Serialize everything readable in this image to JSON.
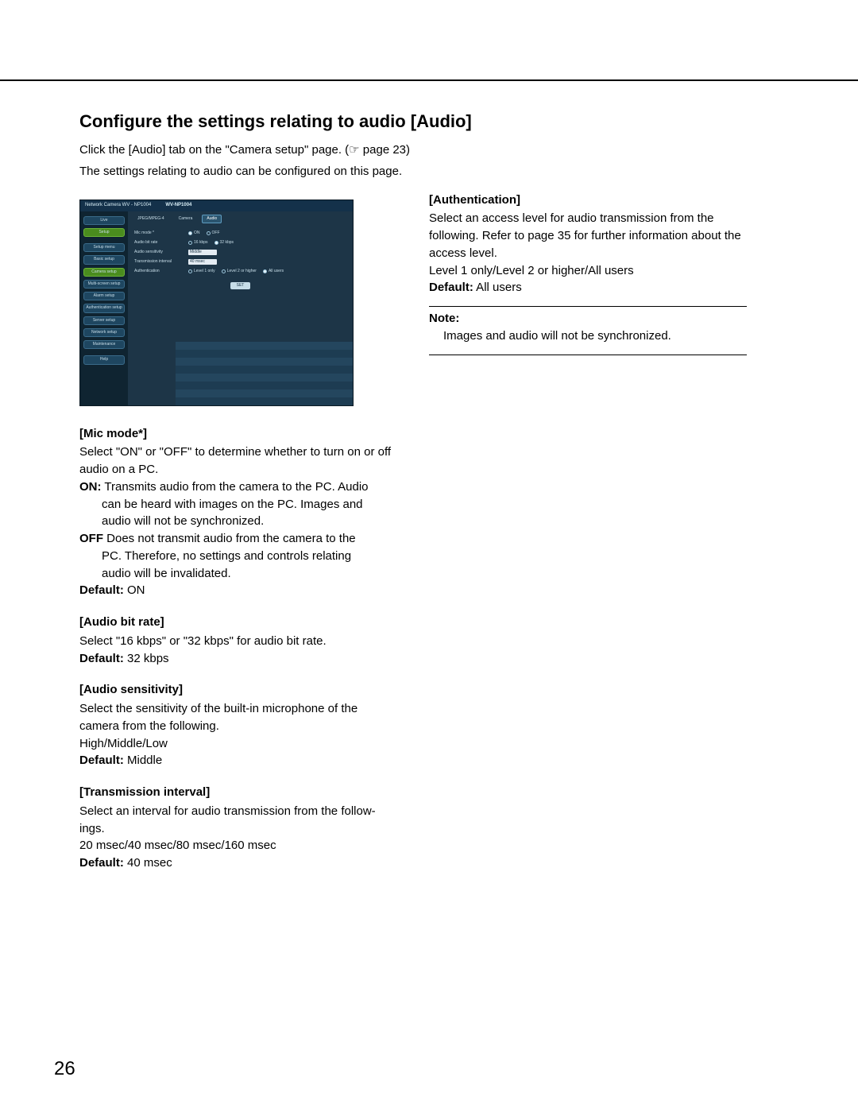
{
  "page": {
    "title": "Configure the settings relating to audio [Audio]",
    "lead_1": "Click the [Audio] tab on the \"Camera setup\" page. (",
    "lead_hand": "☞",
    "lead_pageref": " page 23)",
    "lead_2": "The settings relating to audio can be configured on this page.",
    "number": "26"
  },
  "screenshot": {
    "brand_line": "Network Camera  WV - NP1004",
    "model": "WV-NP1004",
    "side": {
      "live": "Live",
      "setup": "Setup",
      "setup_menu": "Setup menu",
      "basic": "Basic setup",
      "camera": "Camera setup",
      "multi": "Multi-screen setup",
      "alarm": "Alarm setup",
      "auth": "Authentication setup",
      "server": "Server setup",
      "network": "Network setup",
      "maint": "Maintenance",
      "help": "Help"
    },
    "tabs": {
      "jpeg": "JPEG/MPEG-4",
      "camera": "Camera",
      "audio": "Audio"
    },
    "form": {
      "mic_mode": {
        "label": "Mic mode *",
        "opt_on": "ON",
        "opt_off": "OFF"
      },
      "bit_rate": {
        "label": "Audio bit rate",
        "opt_16": "16 kbps",
        "opt_32": "32 kbps"
      },
      "sensitivity": {
        "label": "Audio sensitivity",
        "value": "Middle"
      },
      "interval": {
        "label": "Transmission interval",
        "value": "40 msec"
      },
      "auth": {
        "label": "Authentication",
        "opt_l1": "Level 1 only",
        "opt_l2": "Level 2 or higher",
        "opt_all": "All users"
      },
      "set": "SET"
    }
  },
  "left": {
    "mic_title": "[Mic mode*]",
    "mic_desc": "Select \"ON\" or \"OFF\" to determine whether to turn on or off audio on a PC.",
    "on_label": "ON:",
    "on_rest_line1": " Transmits audio from the camera to the PC. Audio",
    "on_line2": "can be heard with images on the PC. Images and",
    "on_line3": "audio will not be synchronized.",
    "off_label": "OFF",
    "off_rest_line1": " Does not transmit audio from the camera to the",
    "off_line2": "PC. Therefore, no settings and controls relating",
    "off_line3": "audio will be invalidated.",
    "mic_default_label": "Default:",
    "mic_default_val": " ON",
    "rate_title": "[Audio bit rate]",
    "rate_desc": "Select \"16 kbps\" or \"32 kbps\" for audio bit rate.",
    "rate_default_label": "Default:",
    "rate_default_val": " 32 kbps",
    "sens_title": "[Audio sensitivity]",
    "sens_desc1": "Select the sensitivity of the built-in microphone of the camera from the following.",
    "sens_desc2": "High/Middle/Low",
    "sens_default_label": "Default:",
    "sens_default_val": " Middle",
    "intv_title": "[Transmission interval]",
    "intv_desc1_a": "Select an interval for audio transmission from the follow-",
    "intv_desc1_b": "ings.",
    "intv_desc2": "20 msec/40 msec/80 msec/160 msec",
    "intv_default_label": "Default:",
    "intv_default_val": " 40 msec"
  },
  "right": {
    "auth_title": "[Authentication]",
    "auth_desc": "Select an access level for audio transmission from the following. Refer to page 35 for further information about the access level.",
    "auth_opts": "Level 1 only/Level 2 or higher/All users",
    "auth_default_label": "Default:",
    "auth_default_val": " All users",
    "note_label": "Note:",
    "note_body": "Images and audio will not be synchronized."
  }
}
